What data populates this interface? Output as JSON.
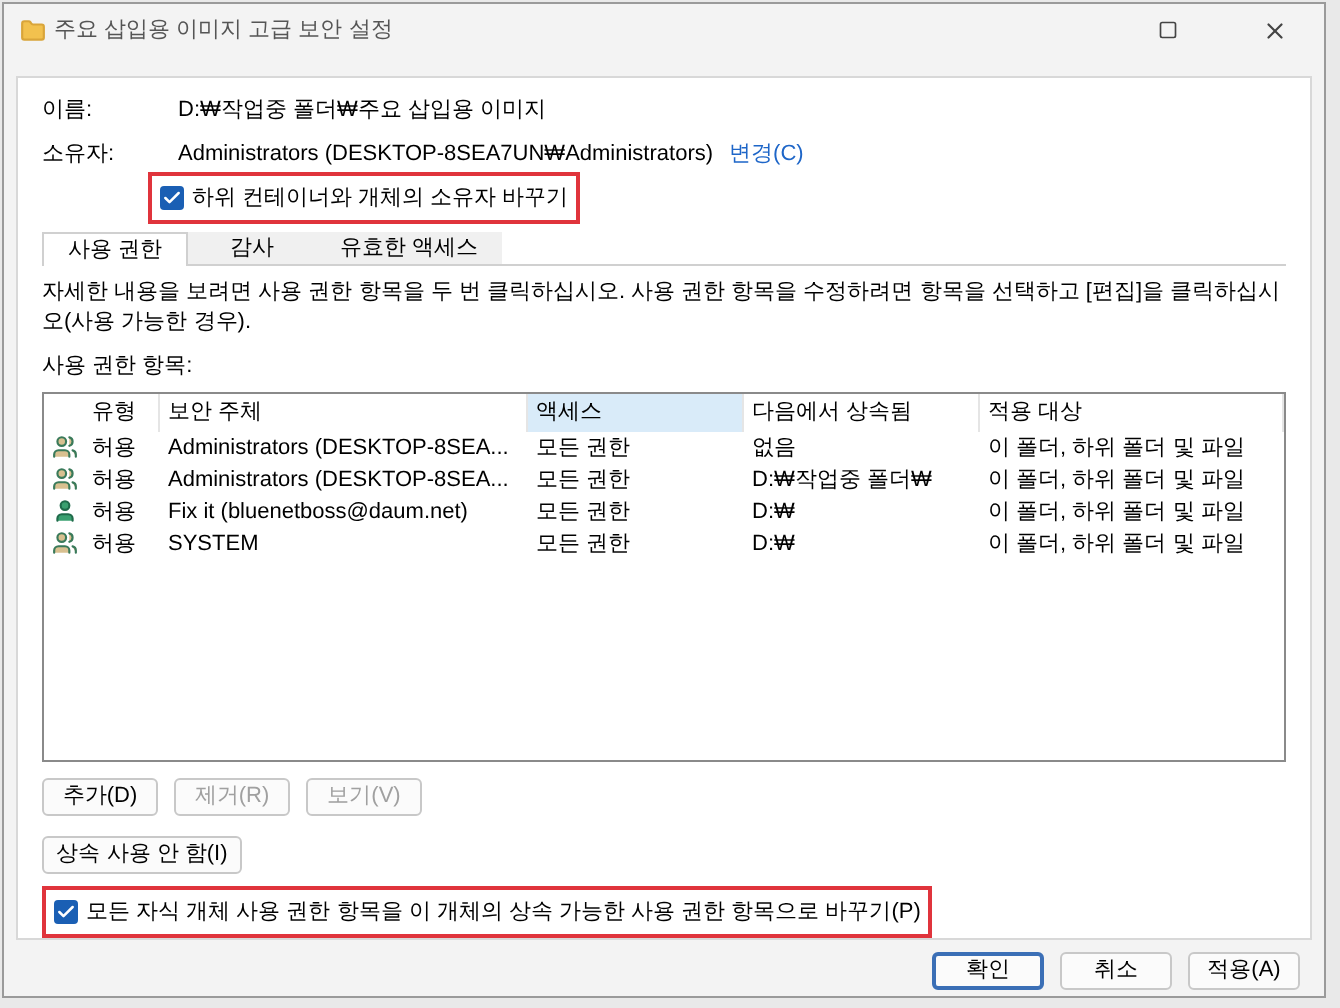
{
  "window": {
    "title": "주요 삽입용 이미지 고급 보안 설정"
  },
  "name_label": "이름:",
  "name_value": "D:₩작업중 폴더₩주요 삽입용 이미지",
  "owner_label": "소유자:",
  "owner_value": "Administrators (DESKTOP-8SEA7UN₩Administrators)",
  "change_link": "변경(C)",
  "owner_checkbox": {
    "label": "하위 컨테이너와 개체의 소유자 바꾸기",
    "checked": true,
    "highlighted": true
  },
  "tabs": [
    {
      "label": "사용 권한",
      "selected": true
    },
    {
      "label": "감사",
      "selected": false
    },
    {
      "label": "유효한 액세스",
      "selected": false
    }
  ],
  "description": "자세한 내용을 보려면 사용 권한 항목을 두 번 클릭하십시오. 사용 권한 항목을 수정하려면 항목을 선택하고 [편집]을 클릭하십시오(사용 가능한 경우).",
  "entries_label": "사용 권한 항목:",
  "table": {
    "columns": [
      {
        "label": "유형",
        "selected": false
      },
      {
        "label": "보안 주체",
        "selected": false
      },
      {
        "label": "액세스",
        "selected": true
      },
      {
        "label": "다음에서 상속됨",
        "selected": false
      },
      {
        "label": "적용 대상",
        "selected": false
      }
    ],
    "rows": [
      {
        "kind": "group",
        "cells": [
          "허용",
          "Administrators (DESKTOP-8SEA...",
          "모든 권한",
          "없음",
          "이 폴더, 하위 폴더 및 파일"
        ]
      },
      {
        "kind": "group",
        "cells": [
          "허용",
          "Administrators (DESKTOP-8SEA...",
          "모든 권한",
          "D:₩작업중 폴더₩",
          "이 폴더, 하위 폴더 및 파일"
        ]
      },
      {
        "kind": "user",
        "cells": [
          "허용",
          "Fix it (bluenetboss@daum.net)",
          "모든 권한",
          "D:₩",
          "이 폴더, 하위 폴더 및 파일"
        ]
      },
      {
        "kind": "group",
        "cells": [
          "허용",
          "SYSTEM",
          "모든 권한",
          "D:₩",
          "이 폴더, 하위 폴더 및 파일"
        ]
      }
    ]
  },
  "entry_buttons": [
    {
      "label": "추가(D)",
      "disabled": false
    },
    {
      "label": "제거(R)",
      "disabled": true
    },
    {
      "label": "보기(V)",
      "disabled": true
    }
  ],
  "inheritance_button": "상속 사용 안 함(I)",
  "replace_checkbox": {
    "label": "모든 자식 개체 사용 권한 항목을 이 개체의 상속 가능한 사용 권한 항목으로 바꾸기(P)",
    "checked": true,
    "highlighted": true
  },
  "dialog_buttons": [
    {
      "label": "확인",
      "default": true
    },
    {
      "label": "취소",
      "default": false
    },
    {
      "label": "적용(A)",
      "default": false
    }
  ]
}
